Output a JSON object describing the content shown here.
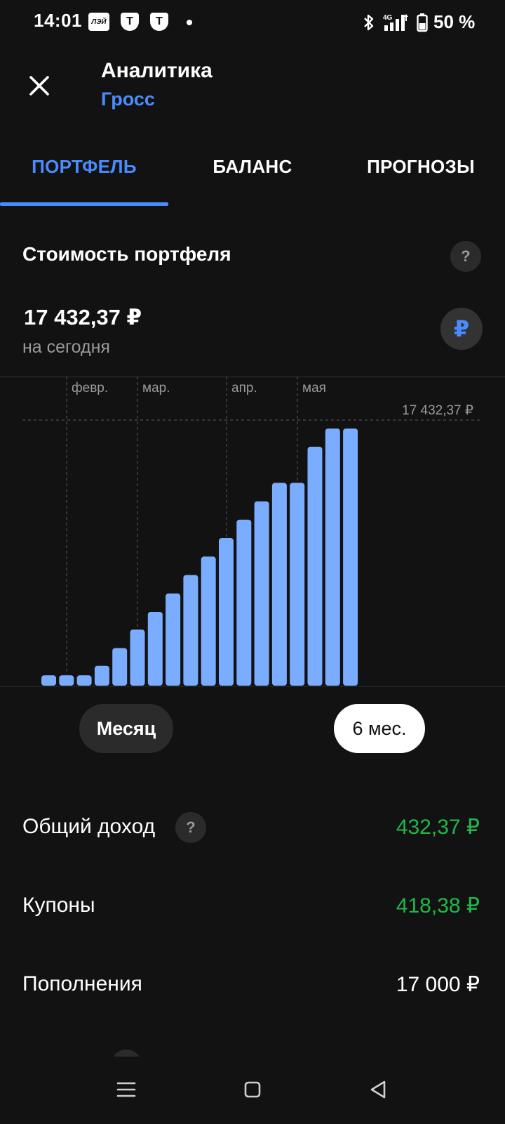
{
  "status_bar": {
    "time": "14:01",
    "icons": [
      "led-app-icon",
      "t-app-icon",
      "t-app-icon",
      "notification-dot-icon",
      "bluetooth-icon",
      "4g-signal-icon",
      "battery-icon"
    ],
    "app_badge_led": "ЛЭЙ",
    "app_badge_t": "Т",
    "network": "4G",
    "battery": "50 %"
  },
  "header": {
    "title": "Аналитика",
    "subtitle": "Гросс"
  },
  "tabs": [
    {
      "label": "ПОРТФЕЛЬ",
      "active": true
    },
    {
      "label": "БАЛАНС",
      "active": false
    },
    {
      "label": "ПРОГНОЗЫ",
      "active": false
    }
  ],
  "portfolio": {
    "title": "Стоимость портфеля",
    "help": "?",
    "value": "17 432,37 ₽",
    "value_note": "на сегодня",
    "currency_symbol": "₽"
  },
  "chart_data": {
    "type": "bar",
    "x_tick_labels": [
      "февр.",
      "мар.",
      "апр.",
      "мая"
    ],
    "max_label": "17 432,37 ₽",
    "max_value": 17432.37,
    "values": [
      700,
      700,
      700,
      1350,
      2550,
      3800,
      5000,
      6250,
      7500,
      8750,
      10000,
      11250,
      12500,
      13750,
      13750,
      16200,
      17432.37,
      17432.37
    ],
    "bar_color": "#7aadff",
    "grid": "vertical dashed lines at month boundaries"
  },
  "periods": {
    "month": "Месяц",
    "six_months": "6 мес.",
    "selected": "6 мес."
  },
  "stats": {
    "total_income_label": "Общий доход",
    "total_income_value": "432,37 ₽",
    "coupons_label": "Купоны",
    "coupons_value": "418,38 ₽",
    "deposits_label": "Пополнения",
    "deposits_value": "17 000 ₽"
  },
  "colors": {
    "background": "#121212",
    "accent": "#4a8cff",
    "positive": "#1fb84a",
    "bar": "#7aadff"
  }
}
